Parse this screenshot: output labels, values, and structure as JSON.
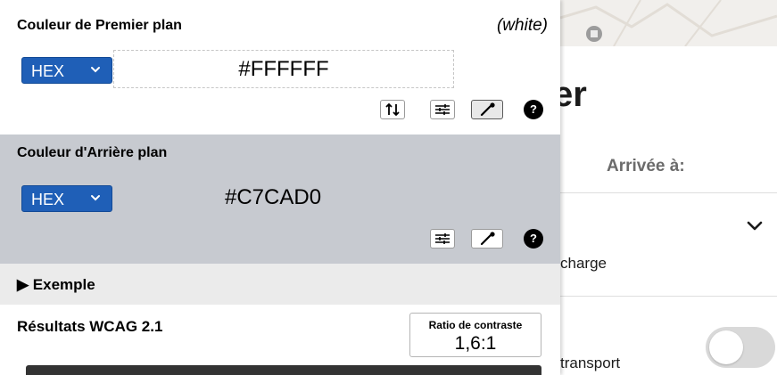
{
  "background_app": {
    "title_fragment": "er",
    "arrival_label": "Arrivée à:",
    "row1_text": "charge",
    "row2_text": "transport",
    "toggle_on": false
  },
  "foreground": {
    "title": "Couleur de Premier plan",
    "color_name": "(white)",
    "format": "HEX",
    "value": "#FFFFFF",
    "tools": [
      "swap-icon",
      "sliders-icon",
      "eyedropper-icon",
      "help-icon"
    ],
    "help_label": "?"
  },
  "background": {
    "title": "Couleur d'Arrière plan",
    "format": "HEX",
    "value": "#C7CAD0",
    "tools": [
      "sliders-icon",
      "eyedropper-icon",
      "help-icon"
    ],
    "help_label": "?"
  },
  "example": {
    "label": "▶ Exemple"
  },
  "results": {
    "title": "Résultats WCAG 2.1",
    "ratio_label": "Ratio de contraste",
    "ratio_value": "1,6:1"
  },
  "colors": {
    "select_bg": "#1f5fb7",
    "bg_section": "#c7cad0",
    "example_bar": "#ebebeb",
    "dark_bar": "#333333"
  }
}
